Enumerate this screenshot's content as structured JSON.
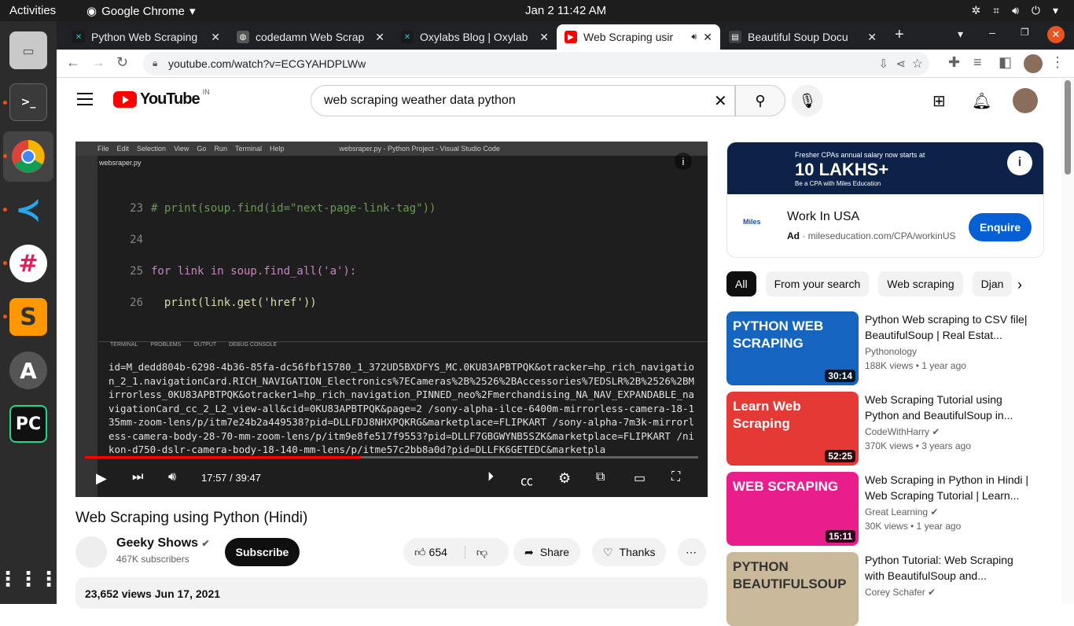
{
  "topbar": {
    "activities": "Activities",
    "app_name": "Google Chrome",
    "datetime": "Jan 2  11:42 AM"
  },
  "tabs": [
    {
      "title": "Python Web Scraping",
      "favicon": "oxylabs-icon",
      "color": "#1a1a1a"
    },
    {
      "title": "codedamn Web Scrap",
      "favicon": "globe-icon",
      "color": "#555"
    },
    {
      "title": "Oxylabs Blog | Oxylab",
      "favicon": "oxylabs-icon",
      "color": "#1a1a1a"
    },
    {
      "title": "Web Scraping usir",
      "favicon": "youtube-icon",
      "color": "#ff0000"
    },
    {
      "title": "Beautiful Soup Docu",
      "favicon": "doc-icon",
      "color": "#3c4043"
    }
  ],
  "address": {
    "url": "youtube.com/watch?v=ECGYAHDPLWw"
  },
  "youtube": {
    "logo": "YouTube",
    "country": "IN",
    "search_query": "web scraping weather data python"
  },
  "player": {
    "vscode_menu": [
      "File",
      "Edit",
      "Selection",
      "View",
      "Go",
      "Run",
      "Terminal",
      "Help"
    ],
    "window_title": "websraper.py - Python Project - Visual Studio Code",
    "file_tab": "websraper.py",
    "code": [
      {
        "ln": "23",
        "text": "# print(soup.find(id=\"next-page-link-tag\"))"
      },
      {
        "ln": "24",
        "text": ""
      },
      {
        "ln": "25",
        "text": "for link in soup.find_all('a'):"
      },
      {
        "ln": "26",
        "text": "  print(link.get('href'))"
      }
    ],
    "terminal_tabs": [
      "TERMINAL",
      "PROBLEMS",
      "OUTPUT",
      "DEBUG CONSOLE"
    ],
    "terminal_output": "id=M_dedd804b-6298-4b36-85fa-dc56fbf15780_1_372UD5BXDFYS_MC.0KU83APBTPQK&otracker=hp_rich_navigation_2_1.navigationCard.RICH_NAVIGATION_Electronics%7ECameras%2B%2526%2BAccessories%7EDSLR%2B%2526%2BMirrorless_0KU83APBTPQK&otracker1=hp_rich_navigation_PINNED_neo%2Fmerchandising_NA_NAV_EXPANDABLE_navigationCard_cc_2_L2_view-all&cid=0KU83APBTPQK&page=2 /sony-alpha-ilce-6400m-mirrorless-camera-18-135mm-zoom-lens/p/itm7e24b2a449538?pid=DLLFDJ8NHXPQKRG&marketplace=FLIPKART /sony-alpha-7m3k-mirrorless-camera-body-28-70-mm-zoom-lens/p/itm9e8fe517f9553?pid=DLLF7GBGWYNB5SZK&marketplace=FLIPKART /nikon-d750-dslr-camera-body-18-140-mm-lens/p/itme57c2bb8a0d?pid=DLLFK6GETEDC&marketpla",
    "time": "17:57 / 39:47",
    "progress": 0.45
  },
  "ad": {
    "banner_line1": "Fresher CPAs annual salary now starts at",
    "banner_line2": "10 LAKHS+",
    "banner_line3": "Be a CPA with Miles Education",
    "advertiser": "Miles",
    "title": "Work In USA",
    "badge": "Ad",
    "domain": "mileseducation.com/CPA/workinUS",
    "cta": "Enquire"
  },
  "chips": [
    "All",
    "From your search",
    "Web scraping",
    "Djan"
  ],
  "recommendations": [
    {
      "title": "Python Web scraping to CSV file| BeautifulSoup | Real Estat...",
      "channel": "Pythonology",
      "verified": false,
      "meta": "188K views  •  1 year ago",
      "duration": "30:14",
      "thumb_text": "PYTHON WEB SCRAPING",
      "thumb_color": "#1565c0"
    },
    {
      "title": "Web Scraping Tutorial using Python and BeautifulSoup in...",
      "channel": "CodeWithHarry",
      "verified": true,
      "meta": "370K views  •  3 years ago",
      "duration": "52:25",
      "thumb_text": "Learn Web Scraping",
      "thumb_color": "#e53935"
    },
    {
      "title": "Web Scraping in Python in Hindi | Web Scraping Tutorial | Learn...",
      "channel": "Great Learning",
      "verified": true,
      "meta": "30K views  •  1 year ago",
      "duration": "15:11",
      "thumb_text": "WEB SCRAPING",
      "thumb_color": "#e91e8c"
    },
    {
      "title": "Python Tutorial: Web Scraping with BeautifulSoup and...",
      "channel": "Corey Schafer",
      "verified": true,
      "meta": "",
      "duration": "",
      "thumb_text": "PYTHON BEAUTIFULSOUP",
      "thumb_color": "#c9b99a"
    }
  ],
  "video": {
    "title": "Web Scraping using Python (Hindi)",
    "channel": "Geeky Shows",
    "subscribers": "467K subscribers",
    "subscribe_label": "Subscribe",
    "likes": "654",
    "share_label": "Share",
    "thanks_label": "Thanks",
    "views_date": "23,652 views  Jun 17, 2021"
  }
}
